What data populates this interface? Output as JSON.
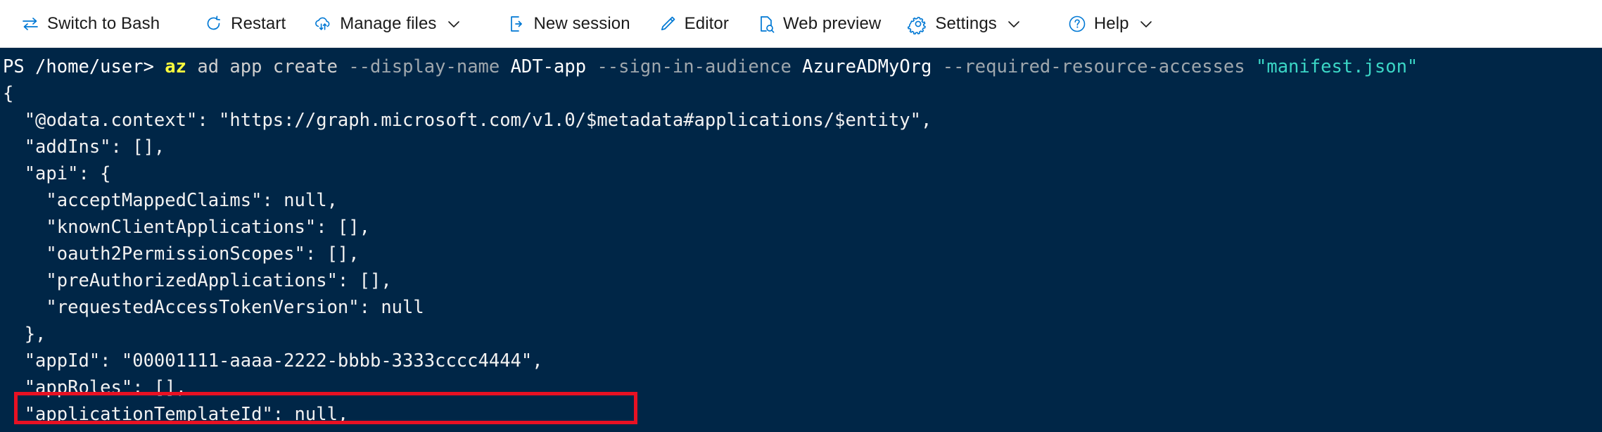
{
  "toolbar": {
    "items": [
      {
        "label": "Switch to Bash",
        "icon": "switch-arrows-icon",
        "caret": false,
        "name": "switch-to-bash"
      },
      {
        "label": "Restart",
        "icon": "restart-icon",
        "caret": false,
        "name": "restart"
      },
      {
        "label": "Manage files",
        "icon": "cloud-upload-download-icon",
        "caret": true,
        "name": "manage-files"
      },
      {
        "label": "New session",
        "icon": "new-session-icon",
        "caret": false,
        "name": "new-session"
      },
      {
        "label": "Editor",
        "icon": "pencil-icon",
        "caret": false,
        "name": "editor"
      },
      {
        "label": "Web preview",
        "icon": "web-preview-icon",
        "caret": false,
        "name": "web-preview"
      },
      {
        "label": "Settings",
        "icon": "gear-icon",
        "caret": true,
        "name": "settings"
      },
      {
        "label": "Help",
        "icon": "question-circle-icon",
        "caret": true,
        "name": "help"
      }
    ]
  },
  "terminal": {
    "background_color": "#002647",
    "prompt": "PS /home/user>",
    "command": {
      "name": "az",
      "subcommands": "ad app create",
      "flag1": "--display-name",
      "value1": "ADT-app",
      "flag2": "--sign-in-audience",
      "value2": "AzureADMyOrg",
      "flag3": "--required-resource-accesses",
      "value3": "\"manifest.json\""
    },
    "output_lines": [
      "{",
      "  \"@odata.context\": \"https://graph.microsoft.com/v1.0/$metadata#applications/$entity\",",
      "  \"addIns\": [],",
      "  \"api\": {",
      "    \"acceptMappedClaims\": null,",
      "    \"knownClientApplications\": [],",
      "    \"oauth2PermissionScopes\": [],",
      "    \"preAuthorizedApplications\": [],",
      "    \"requestedAccessTokenVersion\": null",
      "  },",
      "  \"appId\": \"00001111-aaaa-2222-bbbb-3333cccc4444\",",
      "  \"appRoles\": [],",
      "  \"applicationTemplateId\": null,"
    ],
    "highlight": {
      "target_line": "  \"appId\": \"00001111-aaaa-2222-bbbb-3333cccc4444\",",
      "color": "#e81123"
    }
  }
}
